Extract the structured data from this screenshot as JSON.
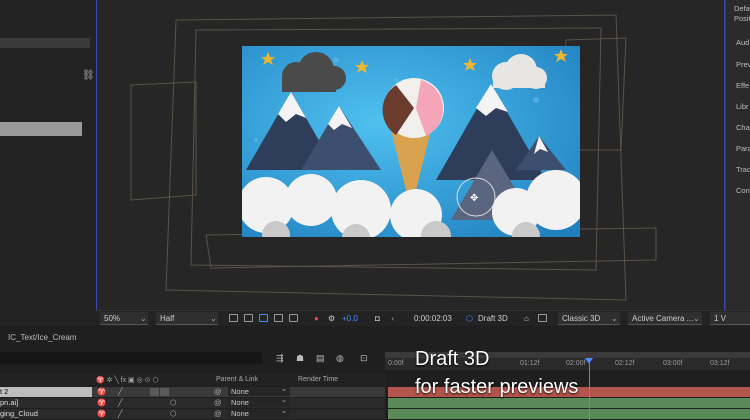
{
  "right_panel": {
    "items": [
      "Defa",
      "Positi",
      "Aud",
      "Prev",
      "Effe",
      "Libr",
      "Cha",
      "Para",
      "Trac",
      "Cont"
    ]
  },
  "toolbar": {
    "zoom": "50%",
    "resolution": "Half",
    "exposure": "+0.0",
    "timecode": "0:00:02:03",
    "draft3d": "Draft 3D",
    "renderer": "Classic 3D",
    "camera": "Active Camera ...",
    "view_count": "1 V"
  },
  "timeline": {
    "tab": "IC_Text/Ice_Cream",
    "ruler_ticks": [
      "0:00f",
      "01:12f",
      "02:00f",
      "02:12f",
      "03:00f",
      "03:12f"
    ],
    "headers": {
      "parent": "Parent & Link",
      "render": "Render Time"
    },
    "layers": [
      {
        "name": "t 2",
        "parent": "None"
      },
      {
        "name": "pn.ai]",
        "parent": "None"
      },
      {
        "name": "ging_Cloud",
        "parent": "None"
      }
    ]
  },
  "caption": {
    "line1": "Draft 3D",
    "line2": "for faster previews"
  },
  "colors": {
    "accent": "#4a8bff",
    "sky": "#3aa0dc",
    "layer_red": "#b3554c",
    "layer_green": "#5a8a58"
  }
}
